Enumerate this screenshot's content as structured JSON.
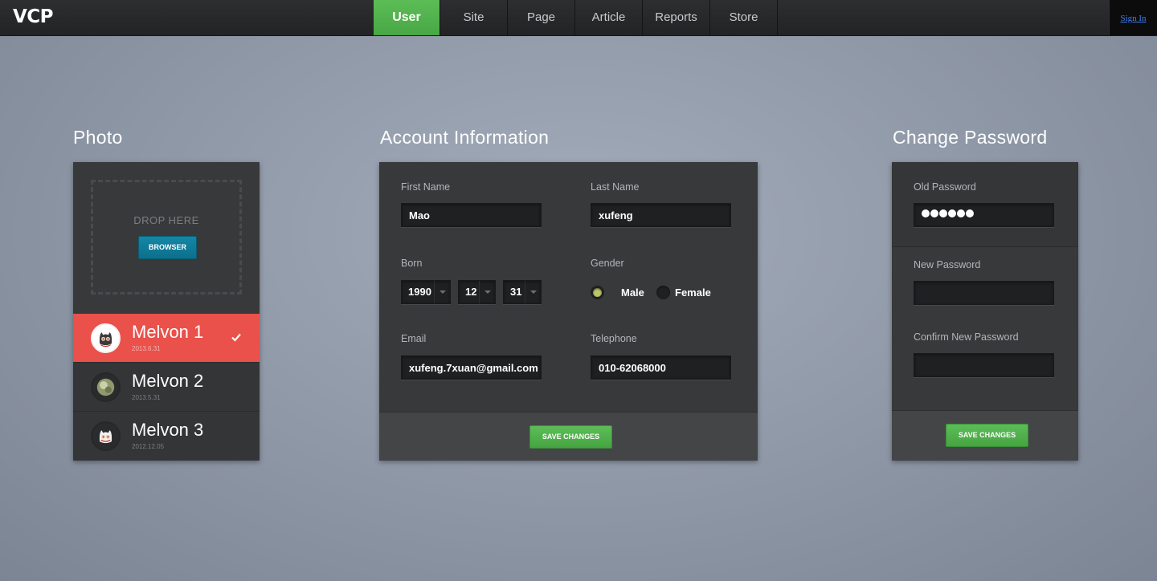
{
  "app": {
    "logo": "VCP"
  },
  "nav": {
    "items": [
      {
        "label": "User",
        "active": true
      },
      {
        "label": "Site"
      },
      {
        "label": "Page"
      },
      {
        "label": "Article"
      },
      {
        "label": "Reports"
      },
      {
        "label": "Store"
      }
    ],
    "sign_in": "Sign In"
  },
  "photo": {
    "title": "Photo",
    "drop_label": "DROP HERE",
    "browse_label": "BROWSER",
    "items": [
      {
        "name": "Melvon 1",
        "date": "2013.6.31",
        "selected": true
      },
      {
        "name": "Melvon 2",
        "date": "2013.5.31"
      },
      {
        "name": "Melvon 3",
        "date": "2012.12.05"
      }
    ]
  },
  "account": {
    "title": "Account Information",
    "first_name": {
      "label": "First Name",
      "value": "Mao"
    },
    "last_name": {
      "label": "Last Name",
      "value": "xufeng"
    },
    "born": {
      "label": "Born",
      "year": "1990",
      "month": "12",
      "day": "31"
    },
    "gender": {
      "label": "Gender",
      "options": [
        "Male",
        "Female"
      ],
      "selected": "Male"
    },
    "email": {
      "label": "Email",
      "value": "xufeng.7xuan@gmail.com"
    },
    "telephone": {
      "label": "Telephone",
      "value": "010-62068000"
    },
    "save_label": "SAVE CHANGES"
  },
  "password": {
    "title": "Change Password",
    "old_label": "Old Password",
    "old_masked_length": 6,
    "new_label": "New Password",
    "confirm_label": "Confirm New Password",
    "save_label": "SAVE CHANGES"
  },
  "colors": {
    "accent_green": "#4caf47",
    "selected_red": "#e9514a",
    "browse_blue": "#117d9c",
    "radio_on": "#bcc56a"
  }
}
